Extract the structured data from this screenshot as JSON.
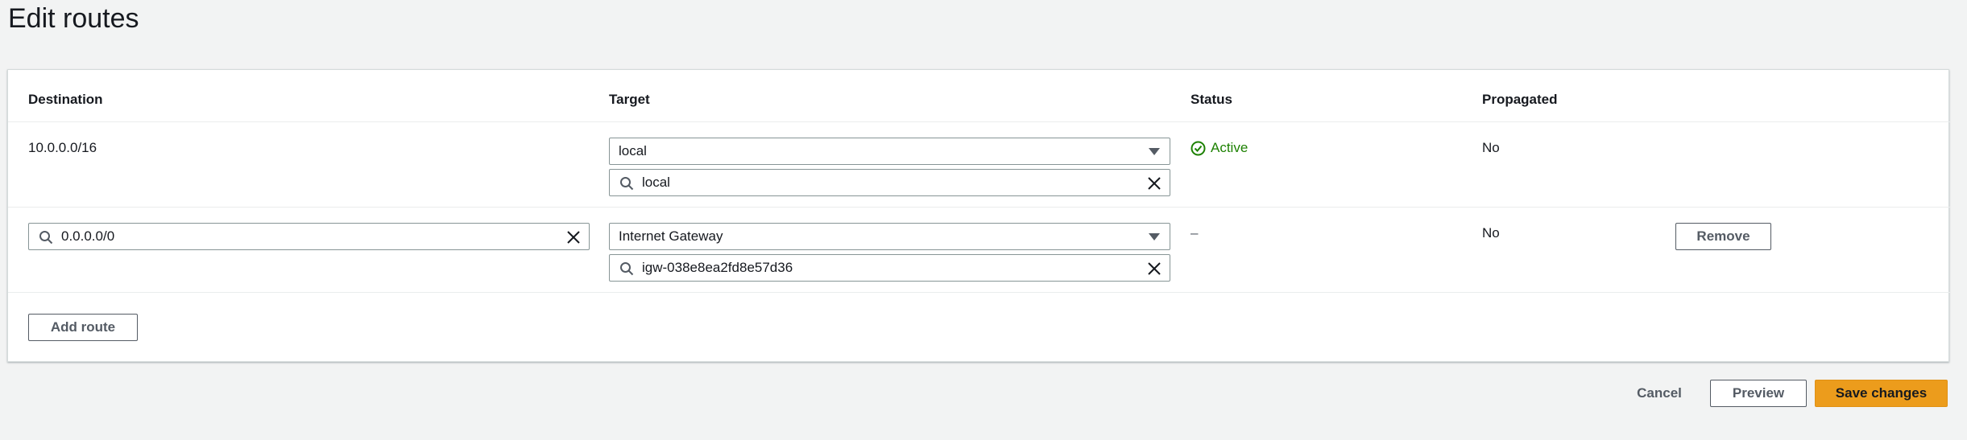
{
  "page": {
    "title": "Edit routes"
  },
  "table": {
    "headers": {
      "destination": "Destination",
      "target": "Target",
      "status": "Status",
      "propagated": "Propagated"
    },
    "rows": [
      {
        "destination": "10.0.0.0/16",
        "target_select": "local",
        "target_search": "local",
        "status": "Active",
        "propagated": "No"
      },
      {
        "destination_search": "0.0.0.0/0",
        "target_select": "Internet Gateway",
        "target_search": "igw-038e8ea2fd8e57d36",
        "status": "–",
        "propagated": "No",
        "remove_label": "Remove"
      }
    ],
    "add_route_label": "Add route"
  },
  "footer": {
    "cancel_label": "Cancel",
    "preview_label": "Preview",
    "save_label": "Save changes"
  },
  "colors": {
    "primary_button": "#ec9c1c",
    "status_active": "#1d8102",
    "background": "#f2f3f3"
  },
  "icons": [
    "search-icon",
    "clear-icon",
    "chevron-down-icon",
    "status-success-icon"
  ]
}
